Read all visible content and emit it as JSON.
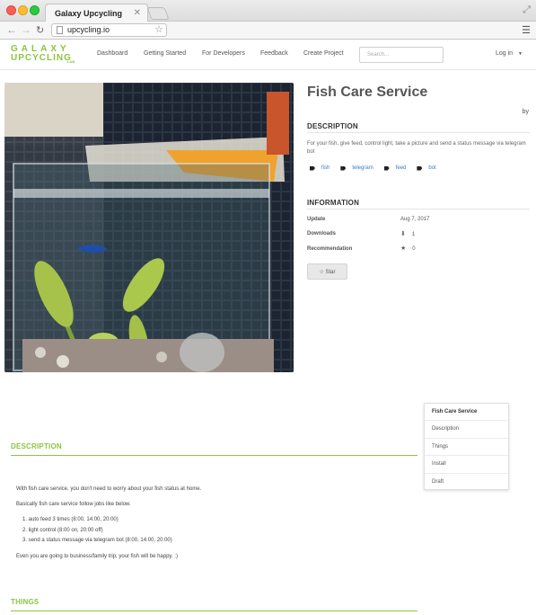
{
  "browser": {
    "tab_title": "Galaxy Upcycling",
    "url": "upcycling.io"
  },
  "site": {
    "logo_line1": "GALAXY",
    "logo_line2": "UPCYCLING",
    "logo_suffix": "LAB",
    "nav": [
      "Dashboard",
      "Getting Started",
      "For Developers",
      "Feedback",
      "Create Project"
    ],
    "search_placeholder": "Search...",
    "login": "Log in"
  },
  "project": {
    "title": "Fish Care Service",
    "by_label": "by",
    "description_head": "DESCRIPTION",
    "summary": "For your fish, give feed, control light, take a picture and send a status message via telegram bot",
    "tags": [
      "fish",
      "telegram",
      "feed",
      "bot"
    ],
    "information_head": "INFORMATION",
    "update_label": "Update",
    "update_value": "Aug 7, 2017",
    "downloads_label": "Downloads",
    "downloads_value": "1",
    "recommendation_label": "Recommendation",
    "recommendation_value": "0",
    "star_button": "Star"
  },
  "toc": [
    "Fish Care Service",
    "Description",
    "Things",
    "Install",
    "Draft"
  ],
  "body": {
    "description_head": "DESCRIPTION",
    "para1": "With fish care service, you don't need to worry about your fish status at home.",
    "para2": "Basically fish care service follow jobs like below.",
    "list": [
      "auto feed 3 times (8:00, 14:00, 20:00)",
      "light control (8:00 on, 20:00 off)",
      "send a status message via telegram bot (8:00, 14:00, 20:00)"
    ],
    "para3": "Even you are going to business/family trip, your fish will be happy. :)",
    "things_head": "THINGS"
  },
  "colors": {
    "accent_green": "#8cc43f",
    "link_blue": "#3a7bc8"
  }
}
